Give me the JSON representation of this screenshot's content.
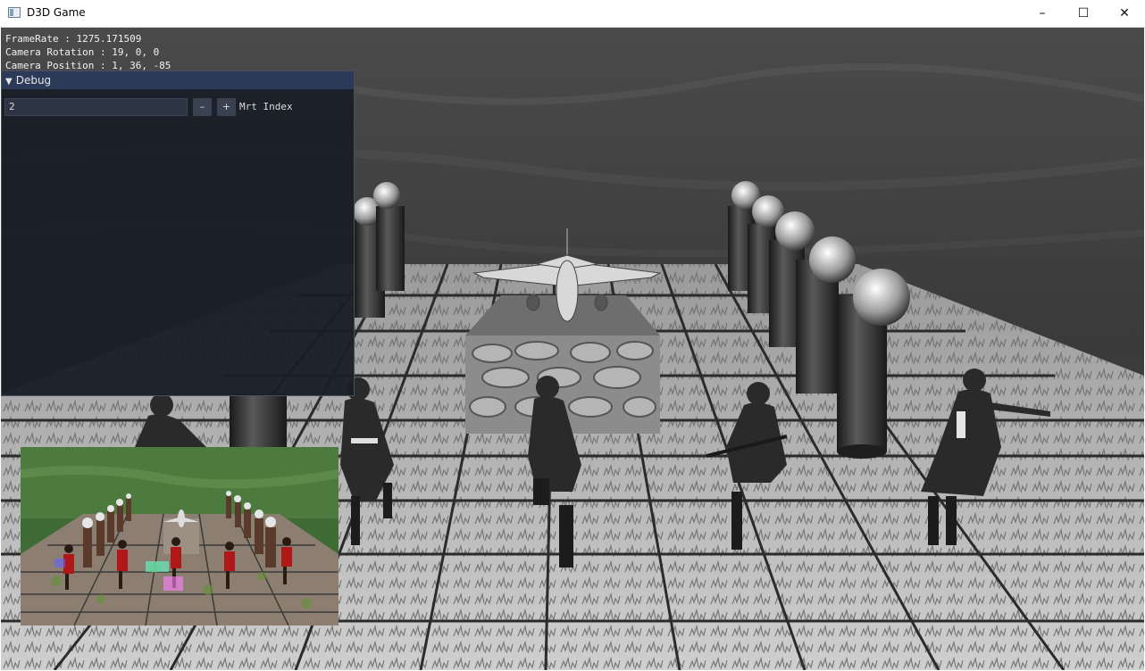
{
  "window": {
    "title": "D3D Game",
    "icon": "app-window-icon",
    "controls": {
      "minimize": "–",
      "maximize": "☐",
      "close": "✕"
    }
  },
  "overlay": {
    "frame_rate": "FrameRate : 1275.171509",
    "camera_rotation": "Camera Rotation : 19, 0, 0",
    "camera_position": "Camera Position : 1, 36, -85"
  },
  "debug": {
    "title": "Debug",
    "mrt_index_value": "2",
    "minus_label": "–",
    "plus_label": "+",
    "mrt_label": "Mrt Index"
  }
}
